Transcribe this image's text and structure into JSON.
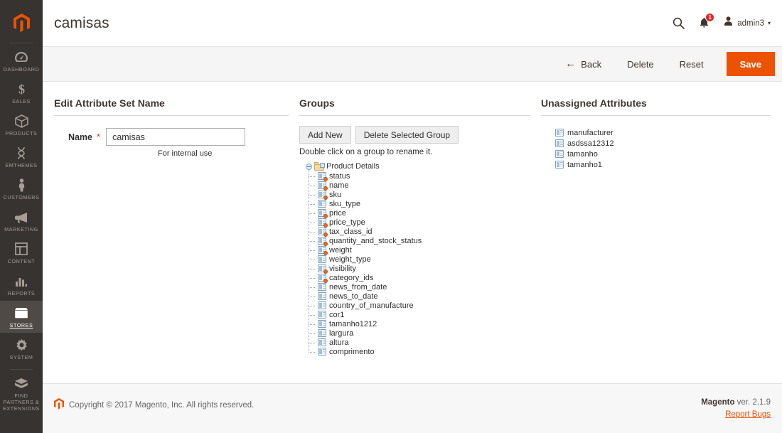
{
  "sidebar": {
    "logo": "magento-logo-icon",
    "items": [
      {
        "label": "DASHBOARD",
        "icon": "dashboard-icon",
        "active": false
      },
      {
        "label": "SALES",
        "icon": "dollar-icon",
        "active": false
      },
      {
        "label": "PRODUCTS",
        "icon": "box-icon",
        "active": false
      },
      {
        "label": "EMTHEMES",
        "icon": "dna-icon",
        "active": false
      },
      {
        "label": "CUSTOMERS",
        "icon": "person-icon",
        "active": false
      },
      {
        "label": "MARKETING",
        "icon": "megaphone-icon",
        "active": false
      },
      {
        "label": "CONTENT",
        "icon": "layout-icon",
        "active": false
      },
      {
        "label": "REPORTS",
        "icon": "bar-chart-icon",
        "active": false
      },
      {
        "label": "STORES",
        "icon": "storefront-icon",
        "active": true
      },
      {
        "label": "SYSTEM",
        "icon": "gear-icon",
        "active": false
      },
      {
        "label": "FIND PARTNERS & EXTENSIONS",
        "icon": "open-box-icon",
        "active": false
      }
    ]
  },
  "header": {
    "title": "camisas",
    "search_icon": "search-icon",
    "notifications_icon": "bell-icon",
    "notifications_count": "1",
    "user_icon": "user-icon",
    "user_name": "admin3",
    "user_caret": "▾"
  },
  "actions": {
    "back": "Back",
    "back_arrow": "←",
    "delete": "Delete",
    "reset": "Reset",
    "save": "Save",
    "save_color": "#eb5202"
  },
  "left_panel": {
    "title": "Edit Attribute Set Name",
    "name_label": "Name",
    "required_mark": "*",
    "name_value": "camisas",
    "name_placeholder": "",
    "note": "For internal use"
  },
  "groups_panel": {
    "title": "Groups",
    "add_new": "Add New",
    "delete_selected_group": "Delete Selected Group",
    "hint": "Double click on a group to rename it.",
    "tree": {
      "root_label": "Product Details",
      "root_icon": "folder-icon",
      "toggle_icon": "collapse-minus-icon",
      "children": [
        {
          "label": "status",
          "system": true
        },
        {
          "label": "name",
          "system": true
        },
        {
          "label": "sku",
          "system": true
        },
        {
          "label": "sku_type",
          "system": false
        },
        {
          "label": "price",
          "system": true
        },
        {
          "label": "price_type",
          "system": true
        },
        {
          "label": "tax_class_id",
          "system": true
        },
        {
          "label": "quantity_and_stock_status",
          "system": true
        },
        {
          "label": "weight",
          "system": true
        },
        {
          "label": "weight_type",
          "system": false
        },
        {
          "label": "visibility",
          "system": true
        },
        {
          "label": "category_ids",
          "system": true
        },
        {
          "label": "news_from_date",
          "system": false
        },
        {
          "label": "news_to_date",
          "system": false
        },
        {
          "label": "country_of_manufacture",
          "system": false
        },
        {
          "label": "cor1",
          "system": false
        },
        {
          "label": "tamanho1212",
          "system": false
        },
        {
          "label": "largura",
          "system": false
        },
        {
          "label": "altura",
          "system": false
        },
        {
          "label": "comprimento",
          "system": false
        }
      ]
    }
  },
  "unassigned_panel": {
    "title": "Unassigned Attributes",
    "items": [
      {
        "label": "manufacturer"
      },
      {
        "label": "asdssa12312"
      },
      {
        "label": "tamanho"
      },
      {
        "label": "tamanho1"
      }
    ]
  },
  "footer": {
    "logo_icon": "magento-mark-icon",
    "copyright": "Copyright © 2017 Magento, Inc. All rights reserved.",
    "brand": "Magento",
    "version": " ver. 2.1.9",
    "report_bugs": "Report Bugs"
  }
}
